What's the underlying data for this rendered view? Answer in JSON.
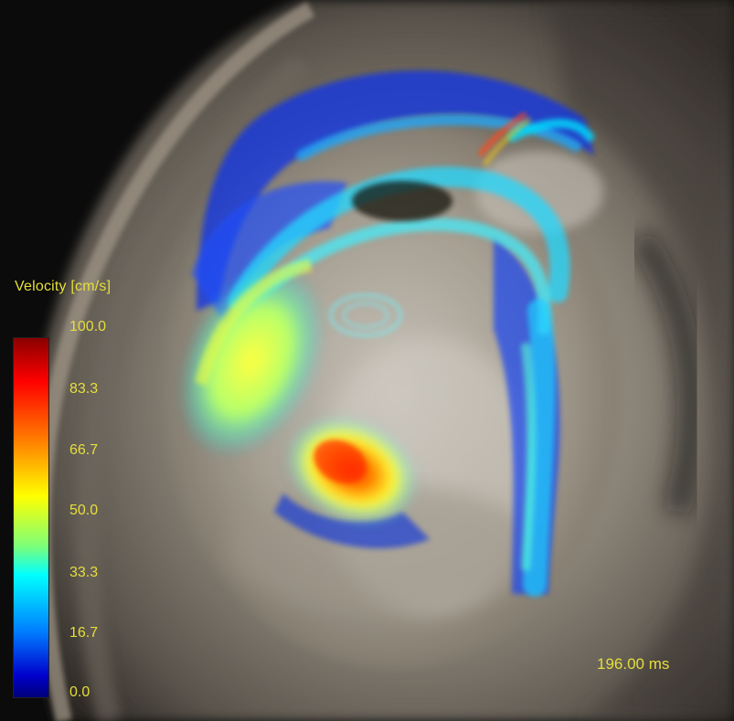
{
  "legend": {
    "title": "Velocity [cm/s]",
    "ticks": [
      "100.0",
      "83.3",
      "66.7",
      "50.0",
      "33.3",
      "16.7",
      "0.0"
    ],
    "colormap": [
      "#8a0000",
      "#ff0000",
      "#ff7a00",
      "#ffff00",
      "#00ffff",
      "#007bff",
      "#00007a"
    ]
  },
  "timestamp": "196.00 ms",
  "colors": {
    "label_text": "#e6df3a"
  }
}
